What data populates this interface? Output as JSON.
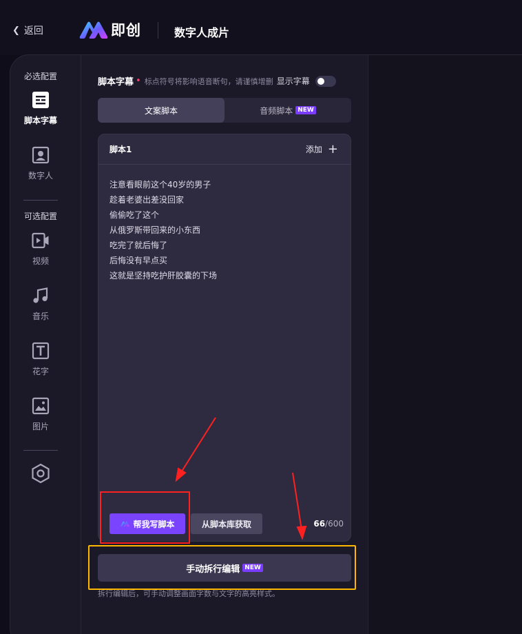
{
  "header": {
    "back_label": "返回",
    "logo_text": "即创",
    "page_title": "数字人成片"
  },
  "rail": {
    "required_section": "必选配置",
    "optional_section": "可选配置",
    "items": [
      {
        "label": "脚本字幕",
        "icon": "script-subtitle-icon",
        "active": true
      },
      {
        "label": "数字人",
        "icon": "avatar-icon",
        "active": false
      },
      {
        "label": "视频",
        "icon": "video-icon",
        "active": false
      },
      {
        "label": "音乐",
        "icon": "music-icon",
        "active": false
      },
      {
        "label": "花字",
        "icon": "text-style-icon",
        "active": false
      },
      {
        "label": "图片",
        "icon": "image-icon",
        "active": false
      },
      {
        "label": "",
        "icon": "settings-hexagon-icon",
        "active": false
      }
    ]
  },
  "panel": {
    "section_title": "脚本字幕",
    "section_hint": "标点符号将影响语音断句，请谨慎增删",
    "toggle_label": "显示字幕",
    "tabs": [
      {
        "label": "文案脚本",
        "active": true
      },
      {
        "label": "音频脚本",
        "badge": "NEW",
        "active": false
      }
    ],
    "script": {
      "title": "脚本1",
      "add_label": "添加",
      "lines": [
        "注意看眼前这个40岁的男子",
        "趁着老婆出差没回家",
        "偷偷吃了这个",
        "从俄罗斯带回来的小东西",
        "吃完了就后悔了",
        "后悔没有早点买",
        "这就是坚持吃护肝胶囊的下场"
      ],
      "ai_button": "帮我写脚本",
      "library_button": "从脚本库获取",
      "count_current": "66",
      "count_max": "/600"
    },
    "manual_button": "手动拆行编辑",
    "manual_badge": "NEW",
    "manual_desc": "拆行编辑后，可手动调整画面字数与文字的高亮样式。"
  },
  "colors": {
    "accent": "#7a44ff",
    "badge": "#7a3cff",
    "required_mark": "#ff3a6e",
    "annotation_red": "#ff2020",
    "annotation_yellow": "#ffb800"
  }
}
